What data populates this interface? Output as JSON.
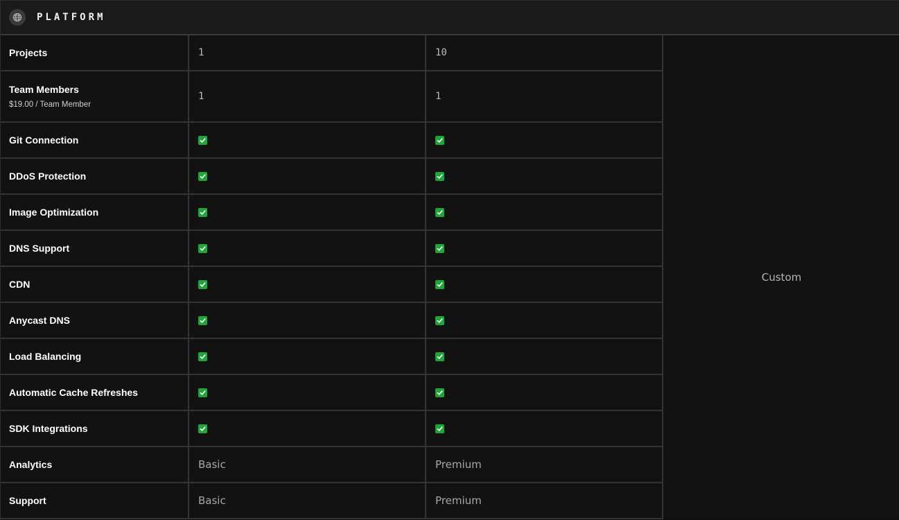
{
  "header": {
    "title": "PLATFORM",
    "icon": "globe-icon"
  },
  "rows": [
    {
      "feature": "Projects",
      "plan1": "1",
      "plan2": "10",
      "kind": "number"
    },
    {
      "feature": "Team Members",
      "subtitle": "$19.00 / Team Member",
      "plan1": "1",
      "plan2": "1",
      "kind": "number"
    },
    {
      "feature": "Git Connection",
      "plan1": true,
      "plan2": true,
      "kind": "check"
    },
    {
      "feature": "DDoS Protection",
      "plan1": true,
      "plan2": true,
      "kind": "check"
    },
    {
      "feature": "Image Optimization",
      "plan1": true,
      "plan2": true,
      "kind": "check"
    },
    {
      "feature": "DNS Support",
      "plan1": true,
      "plan2": true,
      "kind": "check"
    },
    {
      "feature": "CDN",
      "plan1": true,
      "plan2": true,
      "kind": "check"
    },
    {
      "feature": "Anycast DNS",
      "plan1": true,
      "plan2": true,
      "kind": "check"
    },
    {
      "feature": "Load Balancing",
      "plan1": true,
      "plan2": true,
      "kind": "check"
    },
    {
      "feature": "Automatic Cache Refreshes",
      "plan1": true,
      "plan2": true,
      "kind": "check"
    },
    {
      "feature": "SDK Integrations",
      "plan1": true,
      "plan2": true,
      "kind": "check"
    },
    {
      "feature": "Analytics",
      "plan1": "Basic",
      "plan2": "Premium",
      "kind": "text"
    },
    {
      "feature": "Support",
      "plan1": "Basic",
      "plan2": "Premium",
      "kind": "text"
    }
  ],
  "custom_label": "Custom",
  "colors": {
    "background": "#121212",
    "header_bg": "#1a1a1a",
    "check_green": "#22a33b",
    "border": "#343434"
  }
}
